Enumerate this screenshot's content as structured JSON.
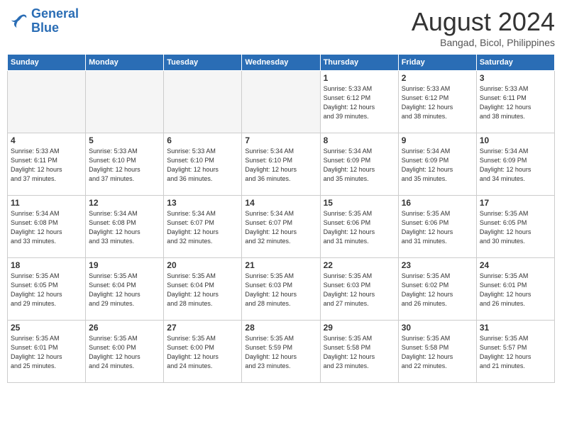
{
  "header": {
    "logo_line1": "General",
    "logo_line2": "Blue",
    "month_year": "August 2024",
    "location": "Bangad, Bicol, Philippines"
  },
  "days_of_week": [
    "Sunday",
    "Monday",
    "Tuesday",
    "Wednesday",
    "Thursday",
    "Friday",
    "Saturday"
  ],
  "weeks": [
    [
      {
        "day": "",
        "info": "",
        "empty": true
      },
      {
        "day": "",
        "info": "",
        "empty": true
      },
      {
        "day": "",
        "info": "",
        "empty": true
      },
      {
        "day": "",
        "info": "",
        "empty": true
      },
      {
        "day": "1",
        "info": "Sunrise: 5:33 AM\nSunset: 6:12 PM\nDaylight: 12 hours\nand 39 minutes."
      },
      {
        "day": "2",
        "info": "Sunrise: 5:33 AM\nSunset: 6:12 PM\nDaylight: 12 hours\nand 38 minutes."
      },
      {
        "day": "3",
        "info": "Sunrise: 5:33 AM\nSunset: 6:11 PM\nDaylight: 12 hours\nand 38 minutes."
      }
    ],
    [
      {
        "day": "4",
        "info": "Sunrise: 5:33 AM\nSunset: 6:11 PM\nDaylight: 12 hours\nand 37 minutes."
      },
      {
        "day": "5",
        "info": "Sunrise: 5:33 AM\nSunset: 6:10 PM\nDaylight: 12 hours\nand 37 minutes."
      },
      {
        "day": "6",
        "info": "Sunrise: 5:33 AM\nSunset: 6:10 PM\nDaylight: 12 hours\nand 36 minutes."
      },
      {
        "day": "7",
        "info": "Sunrise: 5:34 AM\nSunset: 6:10 PM\nDaylight: 12 hours\nand 36 minutes."
      },
      {
        "day": "8",
        "info": "Sunrise: 5:34 AM\nSunset: 6:09 PM\nDaylight: 12 hours\nand 35 minutes."
      },
      {
        "day": "9",
        "info": "Sunrise: 5:34 AM\nSunset: 6:09 PM\nDaylight: 12 hours\nand 35 minutes."
      },
      {
        "day": "10",
        "info": "Sunrise: 5:34 AM\nSunset: 6:09 PM\nDaylight: 12 hours\nand 34 minutes."
      }
    ],
    [
      {
        "day": "11",
        "info": "Sunrise: 5:34 AM\nSunset: 6:08 PM\nDaylight: 12 hours\nand 33 minutes."
      },
      {
        "day": "12",
        "info": "Sunrise: 5:34 AM\nSunset: 6:08 PM\nDaylight: 12 hours\nand 33 minutes."
      },
      {
        "day": "13",
        "info": "Sunrise: 5:34 AM\nSunset: 6:07 PM\nDaylight: 12 hours\nand 32 minutes."
      },
      {
        "day": "14",
        "info": "Sunrise: 5:34 AM\nSunset: 6:07 PM\nDaylight: 12 hours\nand 32 minutes."
      },
      {
        "day": "15",
        "info": "Sunrise: 5:35 AM\nSunset: 6:06 PM\nDaylight: 12 hours\nand 31 minutes."
      },
      {
        "day": "16",
        "info": "Sunrise: 5:35 AM\nSunset: 6:06 PM\nDaylight: 12 hours\nand 31 minutes."
      },
      {
        "day": "17",
        "info": "Sunrise: 5:35 AM\nSunset: 6:05 PM\nDaylight: 12 hours\nand 30 minutes."
      }
    ],
    [
      {
        "day": "18",
        "info": "Sunrise: 5:35 AM\nSunset: 6:05 PM\nDaylight: 12 hours\nand 29 minutes."
      },
      {
        "day": "19",
        "info": "Sunrise: 5:35 AM\nSunset: 6:04 PM\nDaylight: 12 hours\nand 29 minutes."
      },
      {
        "day": "20",
        "info": "Sunrise: 5:35 AM\nSunset: 6:04 PM\nDaylight: 12 hours\nand 28 minutes."
      },
      {
        "day": "21",
        "info": "Sunrise: 5:35 AM\nSunset: 6:03 PM\nDaylight: 12 hours\nand 28 minutes."
      },
      {
        "day": "22",
        "info": "Sunrise: 5:35 AM\nSunset: 6:03 PM\nDaylight: 12 hours\nand 27 minutes."
      },
      {
        "day": "23",
        "info": "Sunrise: 5:35 AM\nSunset: 6:02 PM\nDaylight: 12 hours\nand 26 minutes."
      },
      {
        "day": "24",
        "info": "Sunrise: 5:35 AM\nSunset: 6:01 PM\nDaylight: 12 hours\nand 26 minutes."
      }
    ],
    [
      {
        "day": "25",
        "info": "Sunrise: 5:35 AM\nSunset: 6:01 PM\nDaylight: 12 hours\nand 25 minutes."
      },
      {
        "day": "26",
        "info": "Sunrise: 5:35 AM\nSunset: 6:00 PM\nDaylight: 12 hours\nand 24 minutes."
      },
      {
        "day": "27",
        "info": "Sunrise: 5:35 AM\nSunset: 6:00 PM\nDaylight: 12 hours\nand 24 minutes."
      },
      {
        "day": "28",
        "info": "Sunrise: 5:35 AM\nSunset: 5:59 PM\nDaylight: 12 hours\nand 23 minutes."
      },
      {
        "day": "29",
        "info": "Sunrise: 5:35 AM\nSunset: 5:58 PM\nDaylight: 12 hours\nand 23 minutes."
      },
      {
        "day": "30",
        "info": "Sunrise: 5:35 AM\nSunset: 5:58 PM\nDaylight: 12 hours\nand 22 minutes."
      },
      {
        "day": "31",
        "info": "Sunrise: 5:35 AM\nSunset: 5:57 PM\nDaylight: 12 hours\nand 21 minutes."
      }
    ]
  ]
}
